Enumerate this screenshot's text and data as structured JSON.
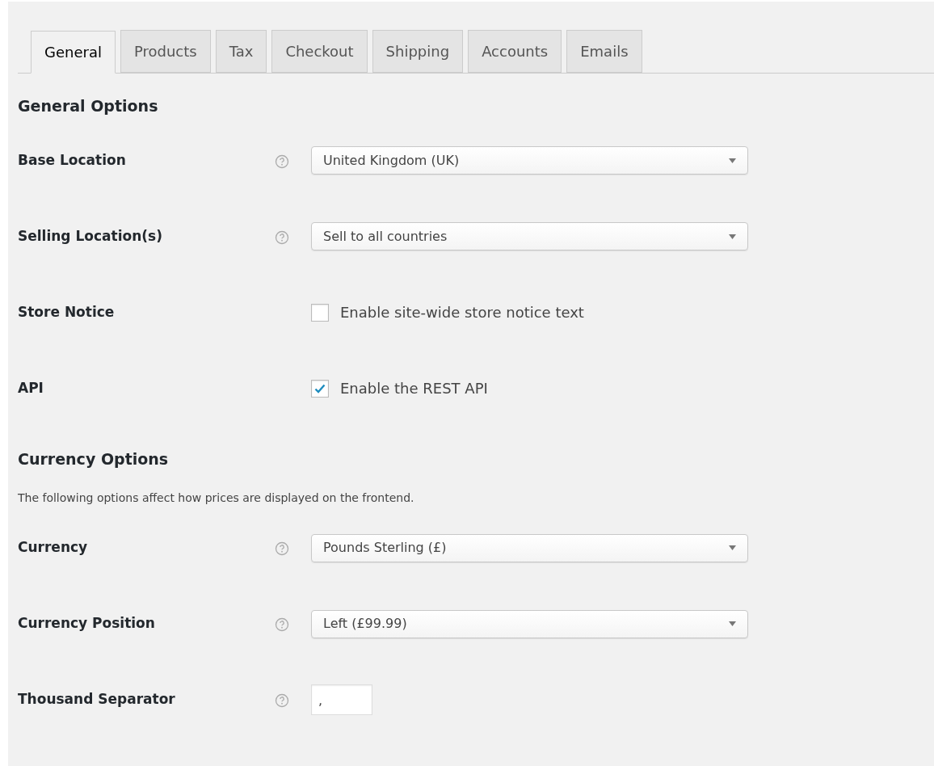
{
  "tabs": [
    {
      "label": "General",
      "selected": true
    },
    {
      "label": "Products",
      "selected": false
    },
    {
      "label": "Tax",
      "selected": false
    },
    {
      "label": "Checkout",
      "selected": false
    },
    {
      "label": "Shipping",
      "selected": false
    },
    {
      "label": "Accounts",
      "selected": false
    },
    {
      "label": "Emails",
      "selected": false
    }
  ],
  "sections": [
    {
      "heading": "General Options",
      "fields": [
        {
          "label": "Base Location",
          "kind": "select",
          "help": true,
          "value": "United Kingdom (UK)"
        },
        {
          "label": "Selling Location(s)",
          "kind": "select",
          "help": true,
          "value": "Sell to all countries"
        },
        {
          "label": "Store Notice",
          "kind": "checkbox",
          "help": false,
          "text": "Enable site-wide store notice text",
          "checked": false
        },
        {
          "label": "API",
          "kind": "checkbox",
          "help": false,
          "text": "Enable the REST API",
          "checked": true
        }
      ]
    },
    {
      "heading": "Currency Options",
      "description": "The following options affect how prices are displayed on the frontend.",
      "fields": [
        {
          "label": "Currency",
          "kind": "select",
          "help": true,
          "value": "Pounds Sterling (£)"
        },
        {
          "label": "Currency Position",
          "kind": "select",
          "help": true,
          "value": "Left (£99.99)"
        },
        {
          "label": "Thousand Separator",
          "kind": "text",
          "help": true,
          "value": ","
        }
      ]
    }
  ]
}
